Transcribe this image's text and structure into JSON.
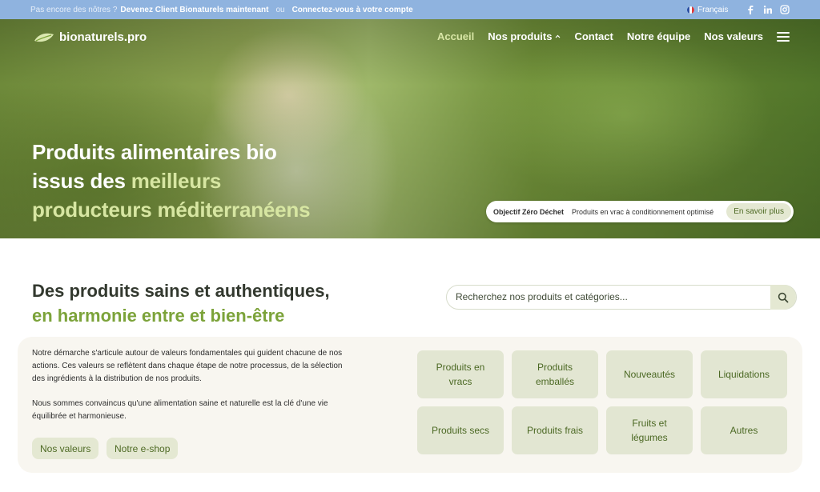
{
  "topbar": {
    "prompt": "Pas encore des nôtres ?",
    "become_client": "Devenez Client Bionaturels maintenant",
    "or": "ou",
    "login": "Connectez-vous à votre compte",
    "language": "Français",
    "social_icons": [
      "facebook-icon",
      "linkedin-icon",
      "instagram-icon"
    ]
  },
  "header": {
    "logo": "bionaturels.pro",
    "nav": {
      "home": "Accueil",
      "products": "Nos produits",
      "contact": "Contact",
      "team": "Notre équipe",
      "values": "Nos valeurs"
    }
  },
  "hero": {
    "title_line1": "Produits alimentaires bio",
    "title_line2_prefix": "issus des",
    "title_line2_accent": "meilleurs",
    "title_line3": "producteurs méditerranéens",
    "badge": {
      "title": "Objectif Zéro Déchet",
      "text": "Produits en vrac à conditionnement optimisé",
      "cta": "En savoir plus"
    }
  },
  "section": {
    "title": "Des produits sains et authentiques,",
    "subtitle": "en harmonie entre et bien-être",
    "search_placeholder": "Recherchez nos produits et catégories...",
    "paragraph1": "Notre démarche s'articule autour de valeurs fondamentales qui guident chacune de nos actions. Ces valeurs se reflètent dans chaque étape de notre processus, de la sélection des ingrédients à la distribution de nos produits.",
    "paragraph2": "Nous sommes convaincus qu'une alimentation saine et naturelle est la clé d'une vie équilibrée et harmonieuse.",
    "btn_values": "Nos valeurs",
    "btn_eshop": "Notre e-shop"
  },
  "categories": [
    "Produits en vracs",
    "Produits emballés",
    "Nouveautés",
    "Liquidations",
    "Produits secs",
    "Produits frais",
    "Fruits et légumes",
    "Autres"
  ],
  "colors": {
    "topbar": "#8fb3df",
    "accent_green": "#7ca33a",
    "tile_bg": "#e2e6d2",
    "tile_text": "#4b6823"
  }
}
